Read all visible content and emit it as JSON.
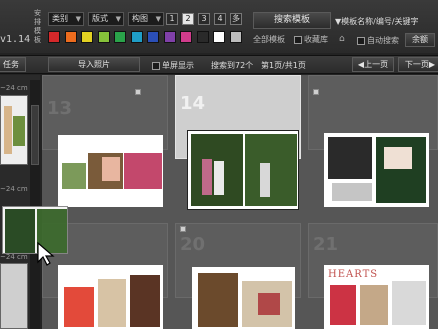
{
  "app": {
    "version": "v1.14"
  },
  "toolbar": {
    "vertical_label": "安排模板",
    "filters": [
      {
        "label": "类别"
      },
      {
        "label": "版式"
      },
      {
        "label": "构图"
      }
    ],
    "pages": [
      "1",
      "2",
      "3",
      "4",
      "多"
    ],
    "active_page": "2",
    "swatches": [
      "#d4282a",
      "#ee6c1e",
      "#e3d122",
      "#86c23a",
      "#2aa34a",
      "#1f9ec7",
      "#2b4fb7",
      "#8040a8",
      "#d13c8c",
      "#2a2a2a",
      "#ffffff",
      "#bdbdbd"
    ],
    "search_button": "搜索模板",
    "search_hint": "模板名称/编号/关键字",
    "all_templates": "全部模板",
    "favorites": "收藏库",
    "auto_search": "自动搜索",
    "more": "余额",
    "left_label": "任务"
  },
  "bar2": {
    "import_button": "导入照片",
    "single_screen": "单屏显示",
    "result_text": "搜索到72个",
    "page_info": "第1页/共1页",
    "prev": "上一页",
    "next": "下一页"
  },
  "side": {
    "size1": "~24 cm",
    "size2": "~24 cm",
    "size3": "~24 cm"
  },
  "grid": {
    "cells": [
      {
        "num": "13"
      },
      {
        "num": "14"
      },
      {
        "num": ""
      },
      {
        "num": ""
      },
      {
        "num": "20"
      },
      {
        "num": "21"
      }
    ],
    "hearts_text": "HEARTS"
  }
}
